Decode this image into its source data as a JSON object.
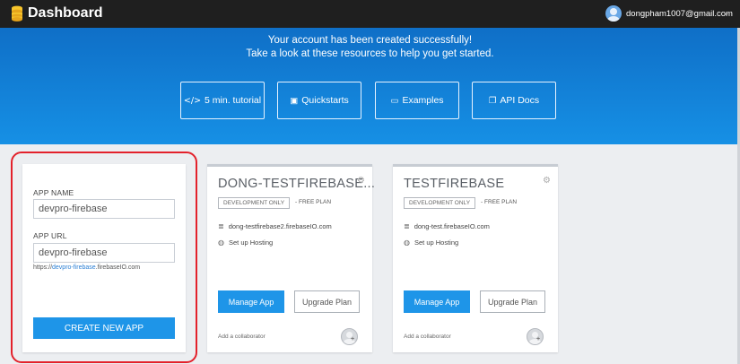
{
  "header": {
    "title": "Dashboard",
    "user_email": "dongpham1007@gmail.com"
  },
  "hero": {
    "line1": "Your account has been created successfully!",
    "line2": "Take a look at these resources to help you get started.",
    "resources": [
      {
        "icon": "code-icon",
        "glyph": "</>",
        "label": "5 min. tutorial"
      },
      {
        "icon": "quickstart-icon",
        "glyph": "▣",
        "label": "Quickstarts"
      },
      {
        "icon": "laptop-icon",
        "glyph": "▭",
        "label": "Examples"
      },
      {
        "icon": "docs-icon",
        "glyph": "❐",
        "label": "API Docs"
      }
    ]
  },
  "create_app": {
    "name_label": "APP NAME",
    "name_value": "devpro-firebase",
    "url_label": "APP URL",
    "url_value": "devpro-firebase",
    "url_hint_prefix": "https://",
    "url_hint_link": "devpro-firebase",
    "url_hint_suffix": ".firebaseIO.com",
    "button": "CREATE NEW APP"
  },
  "apps": [
    {
      "name": "DONG-TESTFIREBASE...",
      "badge": "DEVELOPMENT ONLY",
      "plan": "- FREE PLAN",
      "db_url": "dong-testfirebase2.firebaseIO.com",
      "hosting": "Set up Hosting",
      "manage": "Manage App",
      "upgrade": "Upgrade Plan",
      "collab": "Add a collaborator"
    },
    {
      "name": "TESTFIREBASE",
      "badge": "DEVELOPMENT ONLY",
      "plan": "- FREE PLAN",
      "db_url": "dong-test.firebaseIO.com",
      "hosting": "Set up Hosting",
      "manage": "Manage App",
      "upgrade": "Upgrade Plan",
      "collab": "Add a collaborator"
    }
  ],
  "colors": {
    "accent": "#1e95e8",
    "highlight": "#e3212b",
    "topbar": "#1f1f1f"
  }
}
